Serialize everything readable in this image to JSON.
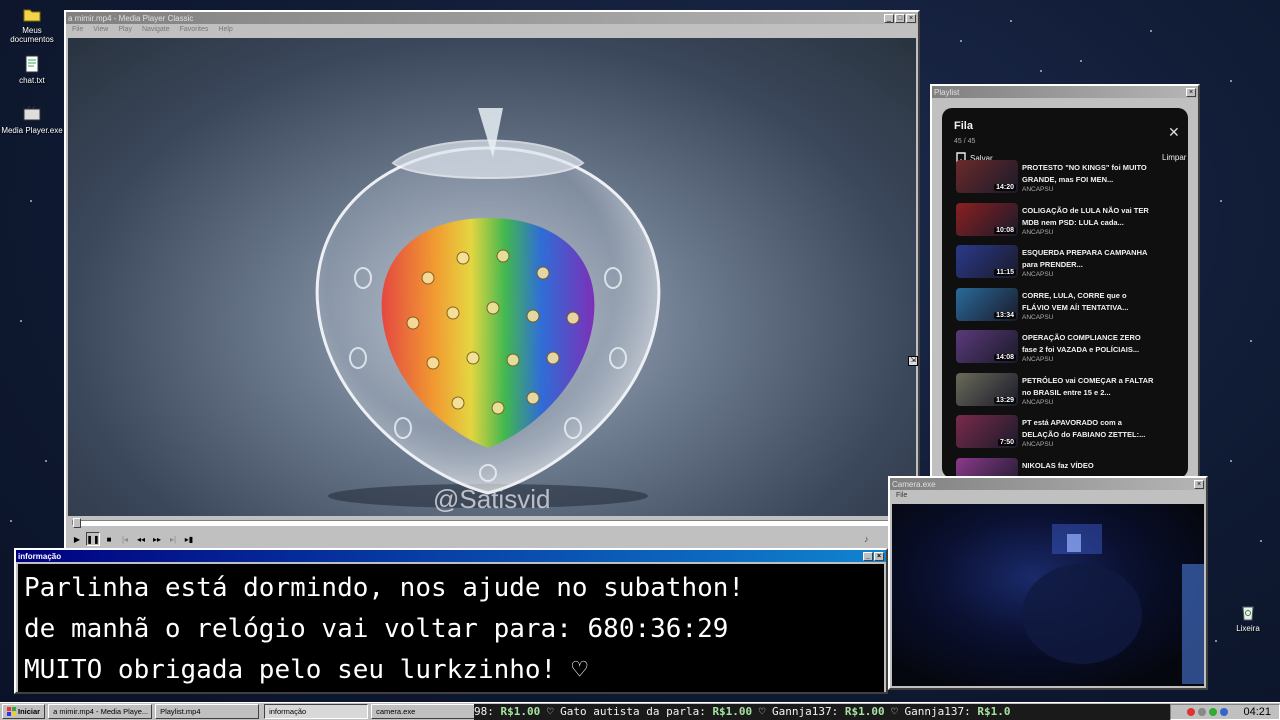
{
  "desktop": {
    "icons": [
      {
        "label": "Meus documentos",
        "icon": "folder-icon"
      },
      {
        "label": "chat.txt",
        "icon": "text-file-icon"
      },
      {
        "label": "Media Player.exe",
        "icon": "media-player-icon"
      },
      {
        "label": "Lixeira",
        "icon": "recycle-bin-icon"
      }
    ]
  },
  "media_player": {
    "title": "a mimir.mp4 - Media Player Classic",
    "menu": [
      "File",
      "View",
      "Play",
      "Navigate",
      "Favorites",
      "Help"
    ],
    "watermark": "@Satisvid"
  },
  "playlist_window": {
    "title": "Playlist",
    "panel_title": "Fila",
    "count": "45 / 45",
    "save_label": "Salvar",
    "clear_label": "Limpar",
    "items": [
      {
        "title": "PROTESTO \"NO KINGS\" foi MUITO GRANDE, mas FOI MEN...",
        "channel": "ANCAPSU",
        "duration": "14:20",
        "thumb": "#6a2a2a"
      },
      {
        "title": "COLIGAÇÃO de LULA NÃO vai TER MDB nem PSD: LULA cada...",
        "channel": "ANCAPSU",
        "duration": "10:08",
        "thumb": "#8a2020"
      },
      {
        "title": "ESQUERDA PREPARA CAMPANHA para PRENDER...",
        "channel": "ANCAPSU",
        "duration": "11:15",
        "thumb": "#2a3a8a"
      },
      {
        "title": "CORRE, LULA, CORRE que o FLÁVIO VEM AÍ! TENTATIVA...",
        "channel": "ANCAPSU",
        "duration": "13:34",
        "thumb": "#2a6a9a"
      },
      {
        "title": "OPERAÇÃO COMPLIANCE ZERO fase 2 foi VAZADA e POLÍCIAIS...",
        "channel": "ANCAPSU",
        "duration": "14:08",
        "thumb": "#5a3a7a"
      },
      {
        "title": "PETRÓLEO vai COMEÇAR a FALTAR no BRASIL entre 15 e 2...",
        "channel": "ANCAPSU",
        "duration": "13:29",
        "thumb": "#6a6a5a"
      },
      {
        "title": "PT está APAVORADO com a DELAÇÃO do FABIANO ZETTEL:...",
        "channel": "ANCAPSU",
        "duration": "7:50",
        "thumb": "#7a2a4a"
      },
      {
        "title": "NIKOLAS faz VÍDEO",
        "channel": "",
        "duration": "",
        "thumb": "#8a3a8a"
      }
    ]
  },
  "info_window": {
    "title": "informação",
    "lines": [
      "Parlinha está dormindo, nos ajude no subathon!",
      "de manhã o relógio vai voltar para:  680:36:29",
      "MUITO obrigada pelo seu lurkzinho! ♡"
    ]
  },
  "camera_window": {
    "title": "Camera.exe",
    "menu": [
      "File"
    ]
  },
  "taskbar": {
    "start_label": "Iniciar",
    "tasks": [
      {
        "label": "a mimir.mp4 - Media Playe...",
        "active": false
      },
      {
        "label": "Playlist.mp4",
        "active": false
      },
      {
        "label": "informação",
        "active": true
      },
      {
        "label": "camera.exe",
        "active": false
      }
    ],
    "ticker": [
      {
        "text": "98: ",
        "price": "R$1.00"
      },
      {
        "text": "  ♡ Gato autista da parla: ",
        "price": "R$1.00"
      },
      {
        "text": "  ♡ Gannja137: ",
        "price": "R$1.00"
      },
      {
        "text": "  ♡ Gannja137: ",
        "price": "R$1.0"
      }
    ],
    "clock": "04:21"
  }
}
